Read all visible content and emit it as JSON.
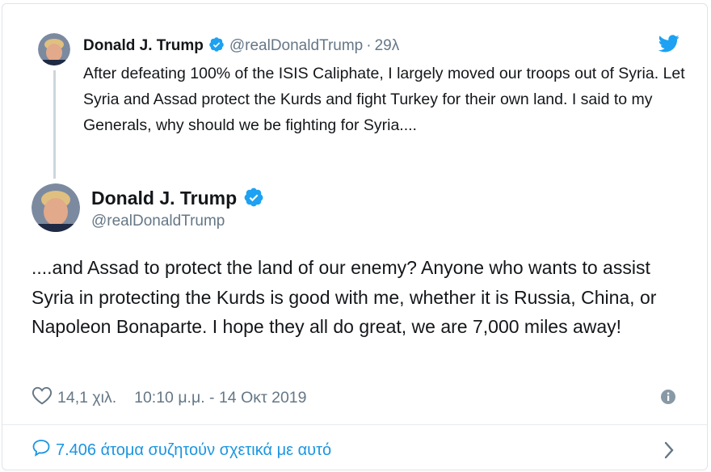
{
  "parent_tweet": {
    "name": "Donald J. Trump",
    "handle": "@realDonaldTrump",
    "separator": "·",
    "time": "29λ",
    "text": "After defeating 100% of the ISIS Caliphate, I largely moved our troops out of Syria. Let Syria and Assad protect the Kurds and fight Turkey for their own land. I said to my Generals, why should we be fighting for Syria...."
  },
  "main_tweet": {
    "name": "Donald J. Trump",
    "handle": "@realDonaldTrump",
    "text": "....and Assad to protect the land of our enemy? Anyone who wants to assist Syria in protecting the Kurds is good with me, whether it is Russia, China, or Napoleon Bonaparte. I hope they all do great, we are 7,000 miles away!",
    "likes": "14,1 χιλ.",
    "timestamp": "10:10 μ.μ. - 14 Οκτ 2019"
  },
  "conversation": {
    "label": "7.406 άτομα συζητούν σχετικά με αυτό"
  },
  "icons": {
    "verified": "verified-badge-icon",
    "bird": "twitter-bird-icon",
    "heart": "heart-icon",
    "info": "info-icon",
    "comment": "comment-bubble-icon",
    "chevron": "chevron-right-icon"
  },
  "colors": {
    "accent": "#1da1f2",
    "link": "#1b95e0",
    "text": "#14171a",
    "muted": "#657786"
  }
}
